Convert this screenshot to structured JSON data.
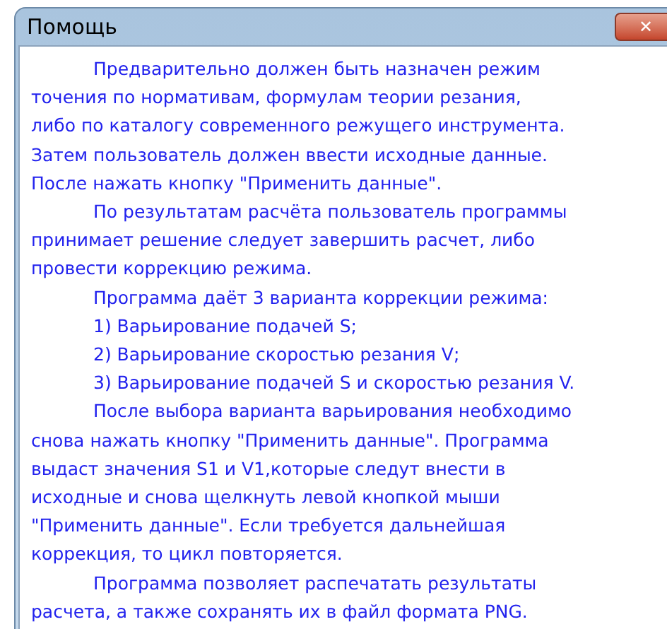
{
  "window": {
    "title": "Помощь",
    "close": "✕"
  },
  "lines": [
    {
      "text": "Предварительно должен быть назначен режим",
      "indented": true
    },
    {
      "text": "точения по нормативам, формулам теории резания,",
      "indented": false
    },
    {
      "text": "либо по каталогу современного режущего инструмента.",
      "indented": false
    },
    {
      "text": "Затем пользователь должен ввести исходные данные.",
      "indented": false
    },
    {
      "text": "После нажать кнопку \"Применить данные\".",
      "indented": false
    },
    {
      "text": "По результатам расчёта пользователь программы",
      "indented": true
    },
    {
      "text": "принимает решение следует завершить расчет, либо",
      "indented": false
    },
    {
      "text": "провести коррекцию режима.",
      "indented": false
    },
    {
      "text": "Программа даёт 3 варианта коррекции режима:",
      "indented": true
    },
    {
      "text": "1) Варьирование подачей S;",
      "indented": true
    },
    {
      "text": "2) Варьирование скоростью резания V;",
      "indented": true
    },
    {
      "text": "3) Варьирование подачей S и скоростью резания V.",
      "indented": true
    },
    {
      "text": "После выбора варианта варьирования необходимо",
      "indented": true
    },
    {
      "text": "снова нажать кнопку \"Применить данные\". Программа",
      "indented": false
    },
    {
      "text": "выдаст значения S1 и V1,которые следут внести в",
      "indented": false
    },
    {
      "text": "исходные и снова щелкнуть левой кнопкой мыши",
      "indented": false
    },
    {
      "text": "\"Применить данные\". Если требуется дальнейшая",
      "indented": false
    },
    {
      "text": "коррекция, то цикл повторяется.",
      "indented": false
    },
    {
      "text": "Программа позволяет распечатать результаты",
      "indented": true
    },
    {
      "text": "расчета, а также сохранять их в файл формата PNG.",
      "indented": false
    }
  ]
}
